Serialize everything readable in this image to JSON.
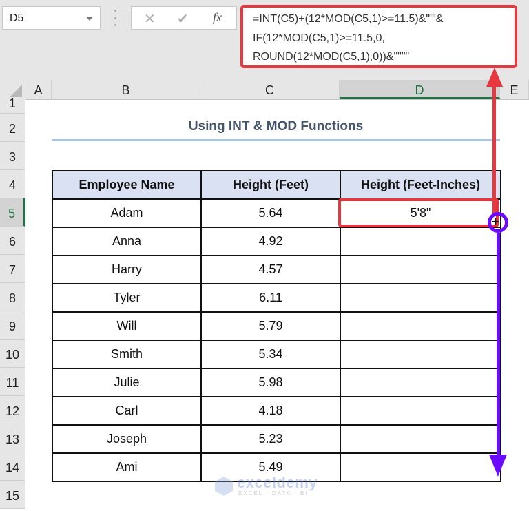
{
  "name_box": {
    "value": "D5"
  },
  "formula_bar": {
    "cancel_icon": "close-icon",
    "enter_icon": "check-icon",
    "fx_label": "fx",
    "formula_lines": [
      "=INT(C5)+(12*MOD(C5,1)>=11.5)&\"'\"&",
      "IF(12*MOD(C5,1)>=11.5,0,",
      "ROUND(12*MOD(C5,1),0))&\"\"\"\""
    ]
  },
  "columns": [
    "A",
    "B",
    "C",
    "D",
    "E"
  ],
  "selected_column": "D",
  "rows": [
    "1",
    "2",
    "3",
    "4",
    "5",
    "6",
    "7",
    "8",
    "9",
    "10",
    "11",
    "12",
    "13",
    "14",
    "15"
  ],
  "selected_row": "5",
  "sheet": {
    "title": "Using INT & MOD Functions",
    "headers": [
      "Employee Name",
      "Height (Feet)",
      "Height (Feet-Inches)"
    ],
    "records": [
      {
        "name": "Adam",
        "feet": "5.64",
        "feet_inches": "5'8\""
      },
      {
        "name": "Anna",
        "feet": "4.92",
        "feet_inches": ""
      },
      {
        "name": "Harry",
        "feet": "4.57",
        "feet_inches": ""
      },
      {
        "name": "Tyler",
        "feet": "6.11",
        "feet_inches": ""
      },
      {
        "name": "Will",
        "feet": "5.79",
        "feet_inches": ""
      },
      {
        "name": "Smith",
        "feet": "5.34",
        "feet_inches": ""
      },
      {
        "name": "Julie",
        "feet": "5.98",
        "feet_inches": ""
      },
      {
        "name": "Carl",
        "feet": "4.18",
        "feet_inches": ""
      },
      {
        "name": "Joseph",
        "feet": "5.23",
        "feet_inches": ""
      },
      {
        "name": "Ami",
        "feet": "5.49",
        "feet_inches": ""
      }
    ]
  },
  "watermark": {
    "name": "exceldemy",
    "tagline": "EXCEL · DATA · BI"
  },
  "colors": {
    "highlight_red": "#e8383f",
    "fill_arrow_purple": "#6a0bff",
    "excel_green": "#217346",
    "header_fill": "#d9e1f2",
    "title_color": "#44546a"
  }
}
